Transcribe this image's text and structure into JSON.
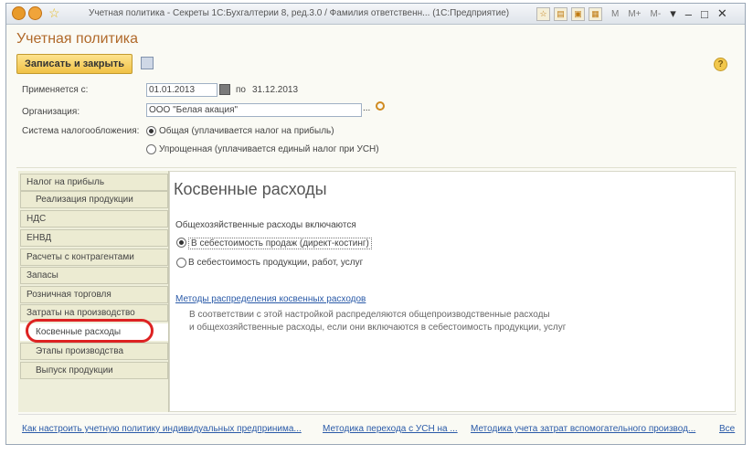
{
  "window": {
    "title": "Учетная политика - Секреты 1С:Бухгалтерии 8, ред.3.0 / Фамилия ответственн... (1С:Предприятие)",
    "controls": [
      "M",
      "M+",
      "M-"
    ]
  },
  "heading": "Учетная политика",
  "toolbar": {
    "save_close_label": "Записать и закрыть"
  },
  "form": {
    "applies_from_label": "Применяется с:",
    "date_from": "01.01.2013",
    "to_label": "по",
    "date_to": "31.12.2013",
    "org_label": "Организация:",
    "org_value": "ООО \"Белая акация\"",
    "tax_system_label": "Система налогообложения:",
    "tax_general": "Общая (уплачивается налог на прибыль)",
    "tax_simplified": "Упрощенная (уплачивается единый налог при УСН)"
  },
  "sidebar": {
    "items": [
      {
        "label": "Налог на прибыль"
      },
      {
        "label": "Реализация продукции"
      },
      {
        "label": "НДС"
      },
      {
        "label": "ЕНВД"
      },
      {
        "label": "Расчеты с контрагентами"
      },
      {
        "label": "Запасы"
      },
      {
        "label": "Розничная торговля"
      },
      {
        "label": "Затраты на производство"
      },
      {
        "label": "Косвенные расходы"
      },
      {
        "label": "Этапы производства"
      },
      {
        "label": "Выпуск продукции"
      }
    ]
  },
  "panel": {
    "title": "Косвенные расходы",
    "general_label": "Общехозяйственные расходы включаются",
    "option_direct": "В себестоимость продаж (директ-костинг)",
    "option_products": "В себестоимость продукции, работ, услуг",
    "methods_link": "Методы распределения косвенных расходов",
    "note_line1": "В соответствии с этой настройкой распределяются общепроизводственные расходы",
    "note_line2": "и общехозяйственные расходы, если они включаются в себестоимость продукции, услуг"
  },
  "footer": {
    "link1": "Как настроить учетную политику индивидуальных предпринима...",
    "link2": "Методика перехода с УСН на ...",
    "link3": "Методика учета затрат вспомогательного производ...",
    "link_all": "Все"
  }
}
